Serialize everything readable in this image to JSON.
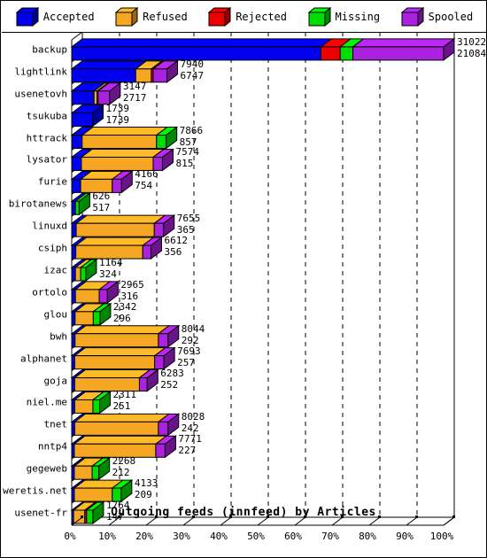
{
  "legend": {
    "items": [
      {
        "label": "Accepted",
        "color": "#0000ee",
        "icon": "cube-icon"
      },
      {
        "label": "Refused",
        "color": "#f5a623",
        "icon": "cube-icon"
      },
      {
        "label": "Rejected",
        "color": "#ee0000",
        "icon": "cube-icon"
      },
      {
        "label": "Missing",
        "color": "#00dd00",
        "icon": "cube-icon"
      },
      {
        "label": "Spooled",
        "color": "#aa22dd",
        "icon": "cube-icon"
      }
    ]
  },
  "chart_data": {
    "type": "bar",
    "orientation": "horizontal",
    "stacked": true,
    "title": "Outgoing feeds (innfeed) by Articles",
    "xlabel": "Outgoing feeds (innfeed) by Articles",
    "ylabel": "",
    "xlim": [
      0,
      100
    ],
    "xtick_labels": [
      "0%",
      "10%",
      "20%",
      "30%",
      "40%",
      "50%",
      "60%",
      "70%",
      "80%",
      "90%",
      "100%"
    ],
    "xticks": [
      0,
      10,
      20,
      30,
      40,
      50,
      60,
      70,
      80,
      90,
      100
    ],
    "grid": true,
    "legend_position": "top",
    "series": [
      {
        "name": "Accepted",
        "color": "#0000ee"
      },
      {
        "name": "Refused",
        "color": "#f5a623"
      },
      {
        "name": "Rejected",
        "color": "#ee0000"
      },
      {
        "name": "Missing",
        "color": "#00dd00"
      },
      {
        "name": "Spooled",
        "color": "#aa22dd"
      }
    ],
    "categories": [
      "backup",
      "lightlink",
      "usenetovh",
      "tsukuba",
      "httrack",
      "lysator",
      "furie",
      "birotanews",
      "linuxd",
      "csiph",
      "izac",
      "ortolo",
      "glou",
      "bwh",
      "alphanet",
      "goja",
      "niel.me",
      "tnet",
      "nntp4",
      "gegeweb",
      "weretis.net",
      "usenet-fr"
    ],
    "rows": [
      {
        "name": "backup",
        "label_top": "31022",
        "label_bottom": "21084",
        "total_pct": 100.0,
        "segments": [
          {
            "series": "Accepted",
            "pct": 67.0
          },
          {
            "series": "Rejected",
            "pct": 5.2
          },
          {
            "series": "Missing",
            "pct": 3.4
          },
          {
            "series": "Spooled",
            "pct": 24.4
          }
        ]
      },
      {
        "name": "lightlink",
        "label_top": "7940",
        "label_bottom": "6747",
        "total_pct": 25.6,
        "segments": [
          {
            "series": "Accepted",
            "pct": 17.2
          },
          {
            "series": "Refused",
            "pct": 4.2
          },
          {
            "series": "Rejected",
            "pct": 0.5
          },
          {
            "series": "Spooled",
            "pct": 3.7
          }
        ]
      },
      {
        "name": "usenetovh",
        "label_top": "3147",
        "label_bottom": "2717",
        "total_pct": 10.2,
        "segments": [
          {
            "series": "Accepted",
            "pct": 6.0
          },
          {
            "series": "Refused",
            "pct": 0.8
          },
          {
            "series": "Rejected",
            "pct": 0.3
          },
          {
            "series": "Spooled",
            "pct": 3.1
          }
        ]
      },
      {
        "name": "tsukuba",
        "label_top": "1739",
        "label_bottom": "1739",
        "total_pct": 5.6,
        "segments": [
          {
            "series": "Accepted",
            "pct": 5.6
          }
        ]
      },
      {
        "name": "httrack",
        "label_top": "7866",
        "label_bottom": "857",
        "total_pct": 25.4,
        "segments": [
          {
            "series": "Accepted",
            "pct": 2.8
          },
          {
            "series": "Refused",
            "pct": 20.0
          },
          {
            "series": "Missing",
            "pct": 2.6
          }
        ]
      },
      {
        "name": "lysator",
        "label_top": "7574",
        "label_bottom": "815",
        "total_pct": 24.4,
        "segments": [
          {
            "series": "Accepted",
            "pct": 2.6
          },
          {
            "series": "Refused",
            "pct": 19.3
          },
          {
            "series": "Spooled",
            "pct": 2.5
          }
        ]
      },
      {
        "name": "furie",
        "label_top": "4166",
        "label_bottom": "754",
        "total_pct": 13.4,
        "segments": [
          {
            "series": "Accepted",
            "pct": 2.4
          },
          {
            "series": "Refused",
            "pct": 8.5
          },
          {
            "series": "Spooled",
            "pct": 2.5
          }
        ]
      },
      {
        "name": "birotanews",
        "label_top": "626",
        "label_bottom": "517",
        "total_pct": 2.0,
        "segments": [
          {
            "series": "Accepted",
            "pct": 1.0
          },
          {
            "series": "Missing",
            "pct": 1.0
          }
        ]
      },
      {
        "name": "linuxd",
        "label_top": "7655",
        "label_bottom": "365",
        "total_pct": 24.7,
        "segments": [
          {
            "series": "Accepted",
            "pct": 1.2
          },
          {
            "series": "Refused",
            "pct": 21.0
          },
          {
            "series": "Spooled",
            "pct": 2.5
          }
        ]
      },
      {
        "name": "csiph",
        "label_top": "6612",
        "label_bottom": "356",
        "total_pct": 21.3,
        "segments": [
          {
            "series": "Accepted",
            "pct": 1.1
          },
          {
            "series": "Refused",
            "pct": 18.0
          },
          {
            "series": "Spooled",
            "pct": 2.2
          }
        ]
      },
      {
        "name": "izac",
        "label_top": "1164",
        "label_bottom": "324",
        "total_pct": 3.8,
        "segments": [
          {
            "series": "Accepted",
            "pct": 1.0
          },
          {
            "series": "Refused",
            "pct": 1.4
          },
          {
            "series": "Missing",
            "pct": 1.4
          }
        ]
      },
      {
        "name": "ortolo",
        "label_top": "2965",
        "label_bottom": "316",
        "total_pct": 9.6,
        "segments": [
          {
            "series": "Accepted",
            "pct": 1.0
          },
          {
            "series": "Refused",
            "pct": 6.4
          },
          {
            "series": "Spooled",
            "pct": 2.2
          }
        ]
      },
      {
        "name": "glou",
        "label_top": "2342",
        "label_bottom": "296",
        "total_pct": 7.6,
        "segments": [
          {
            "series": "Accepted",
            "pct": 0.9
          },
          {
            "series": "Refused",
            "pct": 4.9
          },
          {
            "series": "Missing",
            "pct": 1.8
          }
        ]
      },
      {
        "name": "bwh",
        "label_top": "8044",
        "label_bottom": "292",
        "total_pct": 25.9,
        "segments": [
          {
            "series": "Accepted",
            "pct": 0.9
          },
          {
            "series": "Refused",
            "pct": 22.4
          },
          {
            "series": "Spooled",
            "pct": 2.6
          }
        ]
      },
      {
        "name": "alphanet",
        "label_top": "7693",
        "label_bottom": "257",
        "total_pct": 24.8,
        "segments": [
          {
            "series": "Accepted",
            "pct": 0.8
          },
          {
            "series": "Refused",
            "pct": 21.5
          },
          {
            "series": "Spooled",
            "pct": 2.5
          }
        ]
      },
      {
        "name": "goja",
        "label_top": "6283",
        "label_bottom": "252",
        "total_pct": 20.3,
        "segments": [
          {
            "series": "Accepted",
            "pct": 0.8
          },
          {
            "series": "Refused",
            "pct": 17.4
          },
          {
            "series": "Spooled",
            "pct": 2.1
          }
        ]
      },
      {
        "name": "niel.me",
        "label_top": "2311",
        "label_bottom": "251",
        "total_pct": 7.5,
        "segments": [
          {
            "series": "Accepted",
            "pct": 0.8
          },
          {
            "series": "Refused",
            "pct": 4.9
          },
          {
            "series": "Missing",
            "pct": 1.8
          }
        ]
      },
      {
        "name": "tnet",
        "label_top": "8028",
        "label_bottom": "242",
        "total_pct": 25.9,
        "segments": [
          {
            "series": "Accepted",
            "pct": 0.8
          },
          {
            "series": "Refused",
            "pct": 22.5
          },
          {
            "series": "Spooled",
            "pct": 2.6
          }
        ]
      },
      {
        "name": "nntp4",
        "label_top": "7771",
        "label_bottom": "227",
        "total_pct": 25.1,
        "segments": [
          {
            "series": "Accepted",
            "pct": 0.7
          },
          {
            "series": "Refused",
            "pct": 21.9
          },
          {
            "series": "Spooled",
            "pct": 2.5
          }
        ]
      },
      {
        "name": "gegeweb",
        "label_top": "2268",
        "label_bottom": "212",
        "total_pct": 7.3,
        "segments": [
          {
            "series": "Accepted",
            "pct": 0.7
          },
          {
            "series": "Refused",
            "pct": 4.8
          },
          {
            "series": "Missing",
            "pct": 1.8
          }
        ]
      },
      {
        "name": "weretis.net",
        "label_top": "4133",
        "label_bottom": "209",
        "total_pct": 13.3,
        "segments": [
          {
            "series": "Accepted",
            "pct": 0.7
          },
          {
            "series": "Refused",
            "pct": 10.2
          },
          {
            "series": "Missing",
            "pct": 2.4
          }
        ]
      },
      {
        "name": "usenet-fr",
        "label_top": "1764",
        "label_bottom": "147",
        "total_pct": 5.7,
        "segments": [
          {
            "series": "Accepted",
            "pct": 0.5
          },
          {
            "series": "Refused",
            "pct": 3.0
          },
          {
            "series": "Rejected",
            "pct": 0.5
          },
          {
            "series": "Missing",
            "pct": 1.7
          }
        ]
      }
    ]
  }
}
